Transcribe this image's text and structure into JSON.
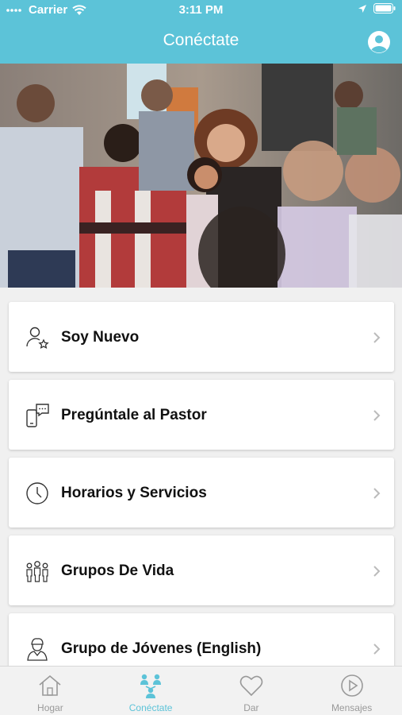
{
  "status_bar": {
    "carrier": "Carrier",
    "time": "3:11 PM"
  },
  "header": {
    "title": "Conéctate",
    "profile_icon": "user-circle-icon"
  },
  "hero": {
    "alt": "church-congregation-photo"
  },
  "menu": [
    {
      "label": "Soy Nuevo",
      "icon": "person-star-icon"
    },
    {
      "label": "Pregúntale al Pastor",
      "icon": "phone-chat-icon"
    },
    {
      "label": "Horarios y Servicios",
      "icon": "clock-icon"
    },
    {
      "label": "Grupos De Vida",
      "icon": "group-icon"
    },
    {
      "label": "Grupo de Jóvenes (English)",
      "icon": "young-person-icon"
    }
  ],
  "tabs": [
    {
      "label": "Hogar",
      "icon": "home-icon",
      "active": false
    },
    {
      "label": "Conéctate",
      "icon": "connect-icon",
      "active": true
    },
    {
      "label": "Dar",
      "icon": "heart-icon",
      "active": false
    },
    {
      "label": "Mensajes",
      "icon": "play-icon",
      "active": false
    }
  ],
  "colors": {
    "accent": "#5cc3d8",
    "inactive": "#999999"
  }
}
